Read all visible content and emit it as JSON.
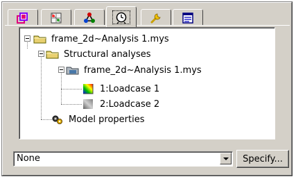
{
  "tabs": [
    {
      "icon": "model-cubes-icon",
      "active": false
    },
    {
      "icon": "mesh-grid-icon",
      "active": false
    },
    {
      "icon": "connections-icon",
      "active": false
    },
    {
      "icon": "clock-icon",
      "active": true
    },
    {
      "icon": "wrench-icon",
      "active": false
    },
    {
      "icon": "properties-window-icon",
      "active": false
    }
  ],
  "tree": {
    "root": {
      "label": "frame_2d~Analysis 1.mys",
      "icon": "folder-icon"
    },
    "structural": {
      "label": "Structural analyses",
      "icon": "folder-icon"
    },
    "analysis": {
      "label": "frame_2d~Analysis 1.mys",
      "icon": "analysis-folder-icon"
    },
    "loadcase1": {
      "label": "1:Loadcase 1",
      "icon": "loadcase-colored-icon"
    },
    "loadcase2": {
      "label": "2:Loadcase 2",
      "icon": "loadcase-gray-icon"
    },
    "model_properties": {
      "label": "Model properties",
      "icon": "model-properties-icon"
    }
  },
  "combo": {
    "value": "None"
  },
  "specify_button": {
    "label": "Specify..."
  }
}
